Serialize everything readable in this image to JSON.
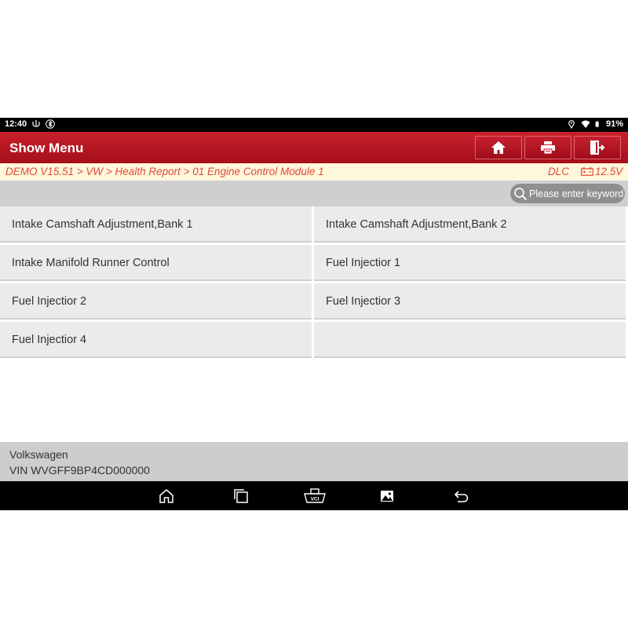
{
  "statusbar": {
    "time": "12:40",
    "battery": "91%"
  },
  "header": {
    "title": "Show Menu",
    "buttons": [
      {
        "icon": "home-icon"
      },
      {
        "icon": "printer-icon"
      },
      {
        "icon": "exit-icon"
      }
    ]
  },
  "breadcrumb": {
    "path": "DEMO V15.51 > VW > Health Report > 01 Engine Control Module 1",
    "dlc": "DLC",
    "voltage": "12.5V"
  },
  "search": {
    "placeholder": "Please enter keyword"
  },
  "menu": {
    "items": [
      "Intake Camshaft Adjustment,Bank 1",
      "Intake Camshaft Adjustment,Bank 2",
      "Intake Manifold Runner Control",
      "Fuel Injectior 1",
      "Fuel Injectior 2",
      "Fuel Injectior 3",
      "Fuel Injectior 4"
    ]
  },
  "vehicle": {
    "make": "Volkswagen",
    "vin": "VIN WVGFF9BP4CD000000"
  },
  "navbar": {
    "vci_label": "VCI"
  },
  "colors": {
    "accent": "#b8141f",
    "breadcrumb_text": "#e0493a"
  }
}
